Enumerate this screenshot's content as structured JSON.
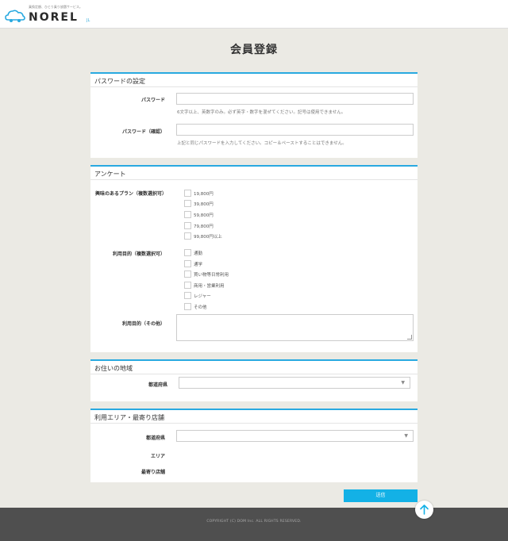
{
  "brand": {
    "tagline": "乗換定額、ひとり乗り放題サービス。",
    "name": "NOREL",
    "suffix": "JL"
  },
  "page": {
    "title": "会員登録"
  },
  "password_section": {
    "title": "パスワードの設定",
    "password_label": "パスワード",
    "password_hint": "6文字以上、英数字のみ。必ず英字・数字を混ぜてください。記号は使用できません。",
    "confirm_label": "パスワード（確認）",
    "confirm_hint": "上記と同じパスワードを入力してください。コピー＆ペーストすることはできません。"
  },
  "survey_section": {
    "title": "アンケート",
    "plan_label": "興味のあるプラン（複数選択可）",
    "plans": [
      "19,800円",
      "39,800円",
      "59,800円",
      "79,800円",
      "99,800円以上"
    ],
    "purpose_label": "利用目的（複数選択可）",
    "purposes": [
      "通勤",
      "通学",
      "買い物等日常利用",
      "商用・営業利用",
      "レジャー",
      "その他"
    ],
    "purpose_other_label": "利用目的（その他）"
  },
  "region_section": {
    "title": "お住いの地域",
    "prefecture_label": "都道府県"
  },
  "area_section": {
    "title": "利用エリア・最寄り店舗",
    "prefecture_label": "都道府県",
    "area_label": "エリア",
    "store_label": "最寄り店舗"
  },
  "actions": {
    "submit_label": "送信"
  },
  "footer": {
    "copyright": "COPYRIGHT (C) DOM Inc. ALL RIGHTS RESERVED."
  },
  "colors": {
    "accent": "#13b1e6",
    "section_border": "#29a9e0",
    "footer_bg": "#4f4f4f"
  },
  "icons": {
    "logo": "car-cloud-icon",
    "select_arrow": "triangle-down-icon",
    "scroll_top": "arrow-up-icon"
  }
}
